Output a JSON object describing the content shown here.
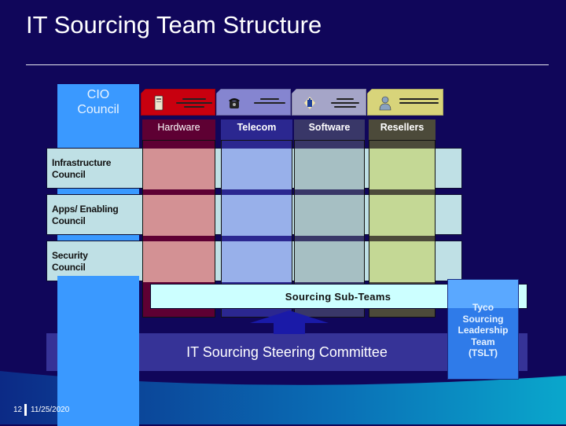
{
  "slide": {
    "title": "IT Sourcing Team Structure",
    "page_number": "12",
    "date": "11/25/2020"
  },
  "cio_council": {
    "label_line1": "CIO",
    "label_line2": "Council"
  },
  "columns": [
    {
      "id": "hardware",
      "label": "Hardware",
      "icon": "server-icon",
      "card_color": "#c8000f",
      "head_color": "#5e0033",
      "body_color": "#d39194",
      "card_text": "illegible"
    },
    {
      "id": "telecom",
      "label": "Telecom",
      "icon": "telephone-icon",
      "card_color": "#8585d0",
      "head_color": "#2b2790",
      "body_color": "#98b0ea",
      "card_text": "illegible"
    },
    {
      "id": "software",
      "label": "Software",
      "icon": "software-box-icon",
      "card_color": "#a5a5c8",
      "head_color": "#393768",
      "body_color": "#a6bfc3",
      "card_text": "illegible"
    },
    {
      "id": "resellers",
      "label": "Resellers",
      "icon": "person-icon",
      "card_color": "#d8d47a",
      "head_color": "#4c4a3a",
      "body_color": "#c4d895",
      "card_text": "illegible"
    }
  ],
  "councils": [
    {
      "line1": "Infrastructure",
      "line2": "Council"
    },
    {
      "line1": "Apps/ Enabling",
      "line2": "Council"
    },
    {
      "line1": "Security",
      "line2": "Council"
    }
  ],
  "sub_teams": {
    "label": "Sourcing Sub-Teams"
  },
  "steering_committee": {
    "label": "IT Sourcing Steering Committee"
  },
  "tslt": {
    "lines": [
      "Tyco",
      "Sourcing",
      "Leadership",
      "Team",
      "(TSLT)"
    ]
  }
}
